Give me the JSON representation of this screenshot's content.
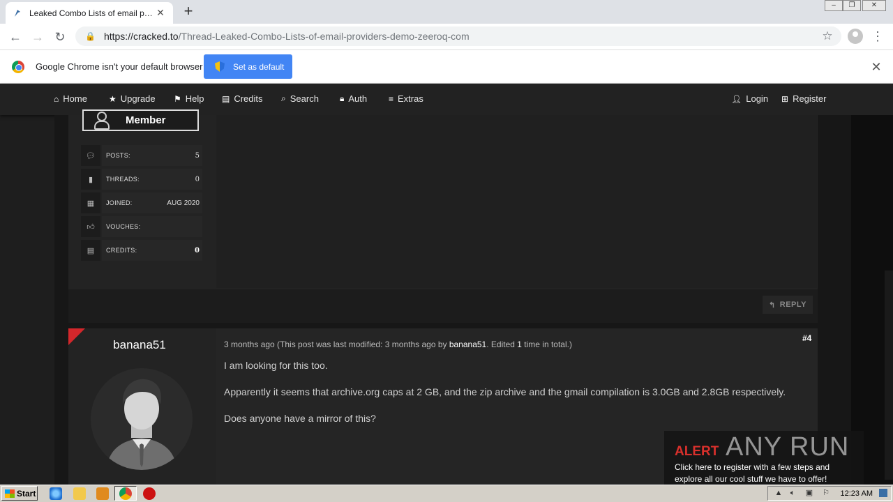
{
  "browser": {
    "tab_title": "Leaked Combo Lists of email providers",
    "url_domain": "https://cracked.to",
    "url_path": "/Thread-Leaked-Combo-Lists-of-email-providers-demo-zeeroq-com",
    "infobar_text": "Google Chrome isn't your default browser",
    "set_default_label": "Set as default"
  },
  "nav": {
    "items": [
      {
        "label": "Home",
        "icon": "home-icon"
      },
      {
        "label": "Upgrade",
        "icon": "star-icon"
      },
      {
        "label": "Help",
        "icon": "flag-icon"
      },
      {
        "label": "Credits",
        "icon": "money-icon"
      },
      {
        "label": "Search",
        "icon": "search-icon"
      },
      {
        "label": "Auth",
        "icon": "lock-icon"
      },
      {
        "label": "Extras",
        "icon": "bars-icon"
      }
    ],
    "login_label": "Login",
    "register_label": "Register"
  },
  "prev_post": {
    "badge_label": "Member",
    "stats": [
      {
        "label": "POSTS:",
        "value": "5"
      },
      {
        "label": "THREADS:",
        "value": "0"
      },
      {
        "label": "JOINED:",
        "value": "AUG 2020"
      },
      {
        "label": "VOUCHES:",
        "value": ""
      },
      {
        "label": "CREDITS:",
        "value": "0"
      }
    ],
    "reply_label": "REPLY"
  },
  "post": {
    "author": "banana51",
    "number": "#4",
    "meta_prefix": "3 months ago (This post was last modified: 3 months ago by ",
    "meta_user": "banana51",
    "meta_mid": ". Edited ",
    "meta_count": "1",
    "meta_suffix": " time in total.)",
    "paragraphs": [
      "I am looking for this too.",
      "Apparently it seems that archive.org caps at 2 GB, and the zip archive and the gmail compilation is 3.0GB and 2.8GB respectively.",
      "Does anyone have a mirror of this?"
    ]
  },
  "alert": {
    "title": "ALERT",
    "brand": "ANY RUN",
    "text": "Click here to register with a few steps and explore all our cool stuff we have to offer!"
  },
  "taskbar": {
    "start_label": "Start",
    "clock": "12:23 AM"
  },
  "colors": {
    "accent_blue": "#4285f4",
    "alert_red": "#d9302c",
    "corner_red": "#d3272b"
  }
}
